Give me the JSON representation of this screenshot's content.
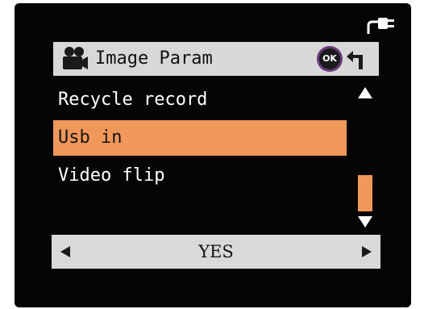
{
  "header": {
    "title": "Image Param",
    "icon": "movie-camera-icon",
    "ok_label": "OK",
    "back_icon": "return-arrow-icon"
  },
  "status": {
    "power_icon": "power-plug-icon"
  },
  "menu": {
    "items": [
      {
        "label": "Recycle record",
        "selected": false
      },
      {
        "label": "Usb in",
        "selected": true
      },
      {
        "label": "Video flip",
        "selected": false
      }
    ],
    "scrollbar": {
      "up_icon": "scroll-up-arrow-icon",
      "down_icon": "scroll-down-arrow-icon"
    }
  },
  "value_selector": {
    "value": "YES",
    "left_icon": "left-arrow-icon",
    "right_icon": "right-arrow-icon"
  },
  "colors": {
    "screen_bg": "#050505",
    "header_bg": "#d8d8d8",
    "highlight": "#f0975a",
    "text_light": "#ffffff",
    "text_dark": "#111111",
    "ok_ring": "#6a3a7a"
  }
}
